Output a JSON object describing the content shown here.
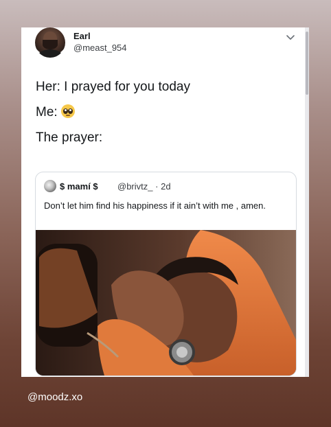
{
  "tweet": {
    "author_name": "Earl",
    "author_handle": "@meast_954",
    "lines": {
      "line1": "Her: I prayed for you today",
      "line2": "Me:",
      "line3": "The prayer:"
    },
    "emoji": "pleading-face"
  },
  "quoted_tweet": {
    "author_name": "$ mamí $",
    "author_handle": "@brivtz_",
    "meta_separator": "·",
    "age": "2d",
    "text": "Don’t let him find his happiness if it ain’t with me , amen."
  },
  "story": {
    "username": "@moodz.xo"
  },
  "icons": {
    "menu": "chevron-down-icon"
  },
  "colors": {
    "text_primary": "#14171a",
    "text_secondary": "#3a3d41",
    "border": "#d6dbe0",
    "hoodie": "#e07a3c"
  }
}
